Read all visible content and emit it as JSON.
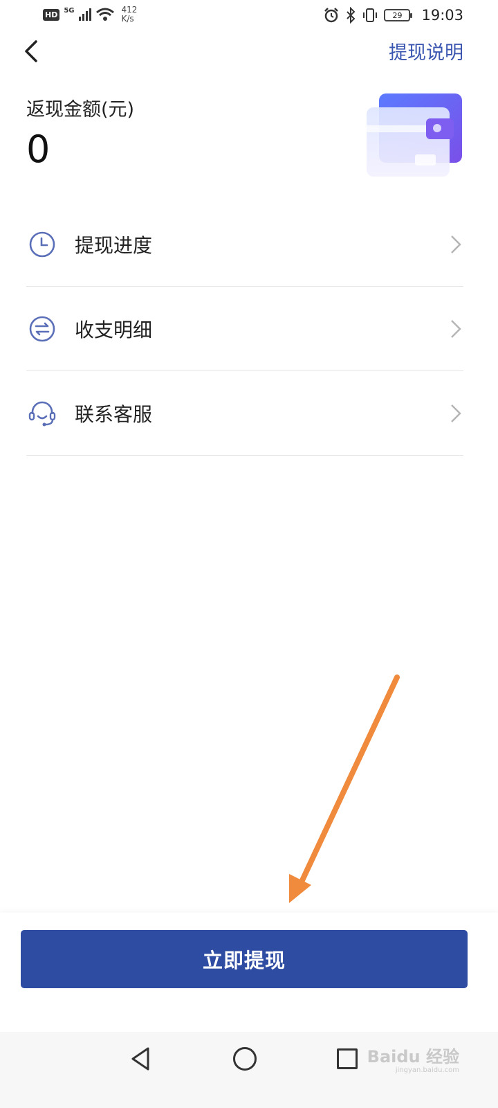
{
  "status_bar": {
    "hd": "HD",
    "network": "5G",
    "speed_value": "412",
    "speed_unit": "K/s",
    "battery": "29",
    "time": "19:03"
  },
  "nav": {
    "explain_link": "提现说明"
  },
  "header": {
    "amount_label": "返现金额(元)",
    "amount_value": "0"
  },
  "menu": [
    {
      "label": "提现进度",
      "icon": "clock-icon"
    },
    {
      "label": "收支明细",
      "icon": "transfer-icon"
    },
    {
      "label": "联系客服",
      "icon": "headset-icon"
    }
  ],
  "primary_button": {
    "label": "立即提现"
  },
  "watermark": {
    "text": "Baidu 经验",
    "sub": "jingyan.baidu.com"
  },
  "colors": {
    "accent": "#2f4ca3",
    "link": "#3a56b0",
    "annotation_arrow": "#f08a3c"
  }
}
